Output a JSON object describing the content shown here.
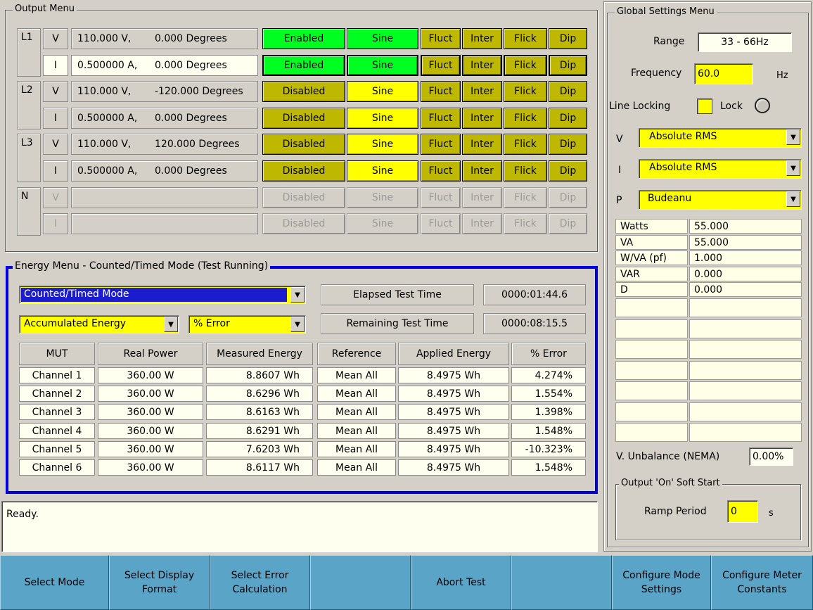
{
  "output_menu": {
    "title": "Output Menu",
    "rows": [
      {
        "phase": "L1",
        "type": "V",
        "value": "110.000 V,",
        "angle": "0.000 Degrees",
        "state": "Enabled",
        "wave": "Sine",
        "f1": "Fluct",
        "f2": "Inter",
        "f3": "Flick",
        "f4": "Dip"
      },
      {
        "phase": "",
        "type": "I",
        "value": "0.500000 A,",
        "angle": "0.000 Degrees",
        "state": "Enabled",
        "wave": "Sine",
        "f1": "Fluct",
        "f2": "Inter",
        "f3": "Flick",
        "f4": "Dip"
      },
      {
        "phase": "L2",
        "type": "V",
        "value": "110.000 V,",
        "angle": "-120.000 Degrees",
        "state": "Disabled",
        "wave": "Sine",
        "f1": "Fluct",
        "f2": "Inter",
        "f3": "Flick",
        "f4": "Dip"
      },
      {
        "phase": "",
        "type": "I",
        "value": "0.500000 A,",
        "angle": "0.000 Degrees",
        "state": "Disabled",
        "wave": "Sine",
        "f1": "Fluct",
        "f2": "Inter",
        "f3": "Flick",
        "f4": "Dip"
      },
      {
        "phase": "L3",
        "type": "V",
        "value": "110.000 V,",
        "angle": "120.000 Degrees",
        "state": "Disabled",
        "wave": "Sine",
        "f1": "Fluct",
        "f2": "Inter",
        "f3": "Flick",
        "f4": "Dip"
      },
      {
        "phase": "",
        "type": "I",
        "value": "0.500000 A,",
        "angle": "0.000 Degrees",
        "state": "Disabled",
        "wave": "Sine",
        "f1": "Fluct",
        "f2": "Inter",
        "f3": "Flick",
        "f4": "Dip"
      },
      {
        "phase": "N",
        "type": "V",
        "value": "",
        "angle": "",
        "state": "Disabled",
        "wave": "Sine",
        "f1": "Fluct",
        "f2": "Inter",
        "f3": "Flick",
        "f4": "Dip"
      },
      {
        "phase": "",
        "type": "I",
        "value": "",
        "angle": "",
        "state": "Disabled",
        "wave": "Sine",
        "f1": "Fluct",
        "f2": "Inter",
        "f3": "Flick",
        "f4": "Dip"
      }
    ]
  },
  "energy_menu": {
    "title": "Energy Menu - Counted/Timed Mode (Test Running)",
    "mode": "Counted/Timed Mode",
    "display": "Accumulated Energy",
    "calc": "% Error",
    "elapsed_label": "Elapsed Test Time",
    "elapsed_value": "0000:01:44.6",
    "remaining_label": "Remaining Test Time",
    "remaining_value": "0000:08:15.5",
    "headers": [
      "MUT",
      "Real Power",
      "Measured Energy",
      "Reference",
      "Applied Energy",
      "% Error"
    ],
    "rows": [
      [
        "Channel 1",
        "360.00 W",
        "8.8607 Wh",
        "Mean All",
        "8.4975 Wh",
        "4.274%"
      ],
      [
        "Channel 2",
        "360.00 W",
        "8.6296 Wh",
        "Mean All",
        "8.4975 Wh",
        "1.554%"
      ],
      [
        "Channel 3",
        "360.00 W",
        "8.6163 Wh",
        "Mean All",
        "8.4975 Wh",
        "1.398%"
      ],
      [
        "Channel 4",
        "360.00 W",
        "8.6291 Wh",
        "Mean All",
        "8.4975 Wh",
        "1.548%"
      ],
      [
        "Channel 5",
        "360.00 W",
        "7.6203 Wh",
        "Mean All",
        "8.4975 Wh",
        "-10.323%"
      ],
      [
        "Channel 6",
        "360.00 W",
        "8.6117 Wh",
        "Mean All",
        "8.4975 Wh",
        "1.548%"
      ]
    ]
  },
  "status": {
    "text": "Ready."
  },
  "global": {
    "title": "Global Settings Menu",
    "range_label": "Range",
    "range_value": "33 - 66Hz",
    "freq_label": "Frequency",
    "freq_value": "60.0",
    "freq_unit": "Hz",
    "line_locking_label": "Line Locking",
    "lock_label": "Lock",
    "v_label": "V",
    "v_value": "Absolute RMS",
    "i_label": "I",
    "i_value": "Absolute RMS",
    "p_label": "P",
    "p_value": "Budeanu",
    "measurements": [
      [
        "Watts",
        "55.000"
      ],
      [
        "VA",
        "55.000"
      ],
      [
        "W/VA (pf)",
        "1.000"
      ],
      [
        "VAR",
        "0.000"
      ],
      [
        "D",
        "0.000"
      ],
      [
        "",
        ""
      ],
      [
        "",
        ""
      ],
      [
        "",
        ""
      ],
      [
        "",
        ""
      ],
      [
        "",
        ""
      ],
      [
        "",
        ""
      ],
      [
        "",
        ""
      ]
    ],
    "unbalance_label": "V. Unbalance (NEMA)",
    "unbalance_value": "0.00%",
    "soft_start_title": "Output 'On' Soft Start",
    "ramp_label": "Ramp Period",
    "ramp_value": "0",
    "ramp_unit": "s"
  },
  "bottom_buttons": [
    "Select Mode",
    "Select Display\nFormat",
    "Select Error\nCalculation",
    "",
    "Abort Test",
    "",
    "Configure Mode\nSettings",
    "Configure Meter\nConstants"
  ],
  "colors": {
    "enabled_green": "#00ff21",
    "olive": "#bfb800",
    "yellow": "#ffff00",
    "bottom_blue": "#5aa4c8",
    "energy_border": "#0000e0"
  }
}
